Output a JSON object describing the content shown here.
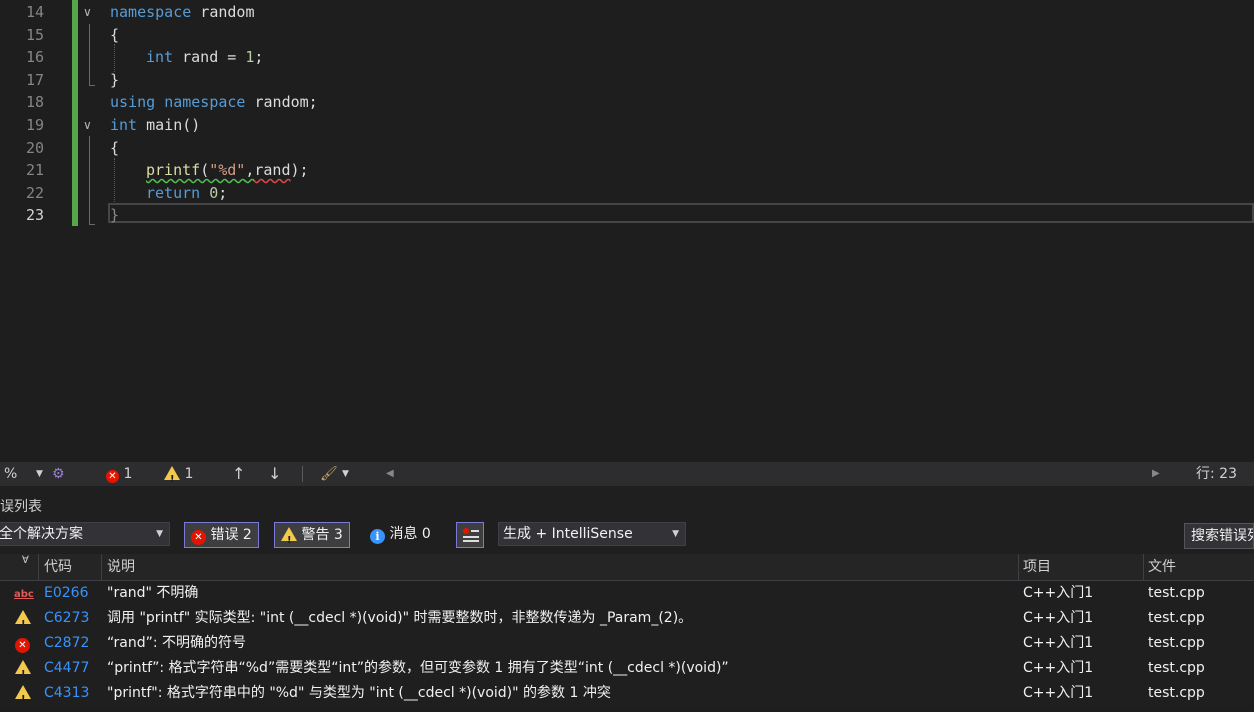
{
  "editor": {
    "lines": [
      {
        "num": "14"
      },
      {
        "num": "15"
      },
      {
        "num": "16"
      },
      {
        "num": "17"
      },
      {
        "num": "18"
      },
      {
        "num": "19"
      },
      {
        "num": "20"
      },
      {
        "num": "21"
      },
      {
        "num": "22"
      },
      {
        "num": "23"
      }
    ],
    "code": {
      "l14_kw": "namespace",
      "l14_id": " random",
      "l15": "{",
      "l16_kw": "int",
      "l16_id": " rand = ",
      "l16_num": "1",
      "l16_end": ";",
      "l17": "}",
      "l18_kw1": "using",
      "l18_sp": " ",
      "l18_kw2": "namespace",
      "l18_id": " random;",
      "l19_kw": "int",
      "l19_id": " main()",
      "l20": "{",
      "l21_fn": "printf",
      "l21_p1": "(",
      "l21_str": "\"%d\"",
      "l21_comma": ",",
      "l21_arg": "rand",
      "l21_end": ");",
      "l22_kw": "return",
      "l22_sp": " ",
      "l22_num": "0",
      "l22_end": ";",
      "l23": "}"
    }
  },
  "statusbar": {
    "zoom": "%",
    "errors": "1",
    "warnings": "1",
    "position": "行: 23"
  },
  "errorlist": {
    "title": "误列表",
    "scope": "全个解决方案",
    "errors_btn": "错误 2",
    "warnings_btn": "警告 3",
    "messages_btn": "消息 0",
    "source": "生成 + IntelliSense",
    "search": "搜索错误列表",
    "headers": {
      "code": "代码",
      "desc": "说明",
      "project": "项目",
      "file": "文件"
    },
    "rows": [
      {
        "code": "E0266",
        "desc": "\"rand\" 不明确",
        "project": "C++入门1",
        "file": "test.cpp",
        "icon": "abc-icon"
      },
      {
        "code": "C6273",
        "desc": "调用 \"printf\" 实际类型: \"int (__cdecl *)(void)\" 时需要整数时，非整数传递为 _Param_(2)。",
        "project": "C++入门1",
        "file": "test.cpp",
        "icon": "warning-icon"
      },
      {
        "code": "C2872",
        "desc": "“rand”: 不明确的符号",
        "project": "C++入门1",
        "file": "test.cpp",
        "icon": "error-icon"
      },
      {
        "code": "C4477",
        "desc": "“printf”: 格式字符串“%d”需要类型“int”的参数，但可变参数 1 拥有了类型“int (__cdecl *)(void)”",
        "project": "C++入门1",
        "file": "test.cpp",
        "icon": "warning-icon"
      },
      {
        "code": "C4313",
        "desc": "\"printf\": 格式字符串中的 \"%d\" 与类型为 \"int (__cdecl *)(void)\" 的参数 1 冲突",
        "project": "C++入门1",
        "file": "test.cpp",
        "icon": "warning-icon"
      }
    ]
  },
  "colors": {
    "accent": "#3794ff",
    "error": "#e51400",
    "warning": "#f2c94c",
    "changebar": "#57a64a"
  }
}
